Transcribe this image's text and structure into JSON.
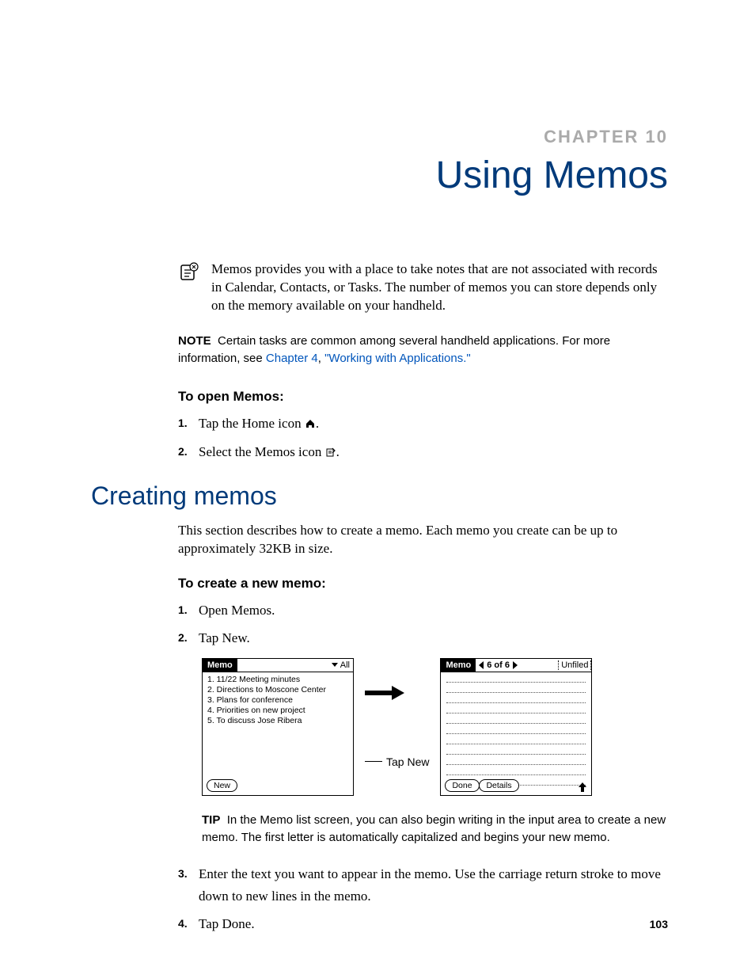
{
  "chapter": {
    "label": "CHAPTER 10",
    "title": "Using Memos"
  },
  "intro": "Memos provides you with a place to take notes that are not associated with records in Calendar, Contacts, or Tasks. The number of memos you can store depends only on the memory available on your handheld.",
  "note": {
    "label": "NOTE",
    "before": "Certain tasks are common among several handheld applications. For more information, see ",
    "link1": "Chapter 4",
    "sep": ", ",
    "link2": "\"Working with Applications.\""
  },
  "open_memos": {
    "heading": "To open Memos:",
    "steps": [
      "Tap the Home icon",
      "Select the Memos icon"
    ]
  },
  "section_heading": "Creating memos",
  "section_intro": "This section describes how to create a memo. Each memo you create can be up to approximately 32KB in size.",
  "create_memo": {
    "heading": "To create a new memo:",
    "steps12": [
      "Open Memos.",
      "Tap New."
    ],
    "steps34": [
      "Enter the text you want to appear in the memo. Use the carriage return stroke to move down to new lines in the memo.",
      "Tap Done."
    ]
  },
  "screens": {
    "list": {
      "title": "Memo",
      "filter": "All",
      "items": [
        "1. 11/22 Meeting minutes",
        "2. Directions to Moscone Center",
        "3. Plans for conference",
        "4. Priorities on new project",
        "5. To discuss Jose Ribera"
      ],
      "new_button": "New"
    },
    "detail": {
      "title": "Memo",
      "counter": "6 of 6",
      "category": "Unfiled",
      "done_button": "Done",
      "details_button": "Details"
    },
    "callout": "Tap New"
  },
  "tip": {
    "label": "TIP",
    "text": "In the Memo list screen, you can also begin writing in the input area to create a new memo. The first letter is automatically capitalized and begins your new memo."
  },
  "page_number": "103"
}
